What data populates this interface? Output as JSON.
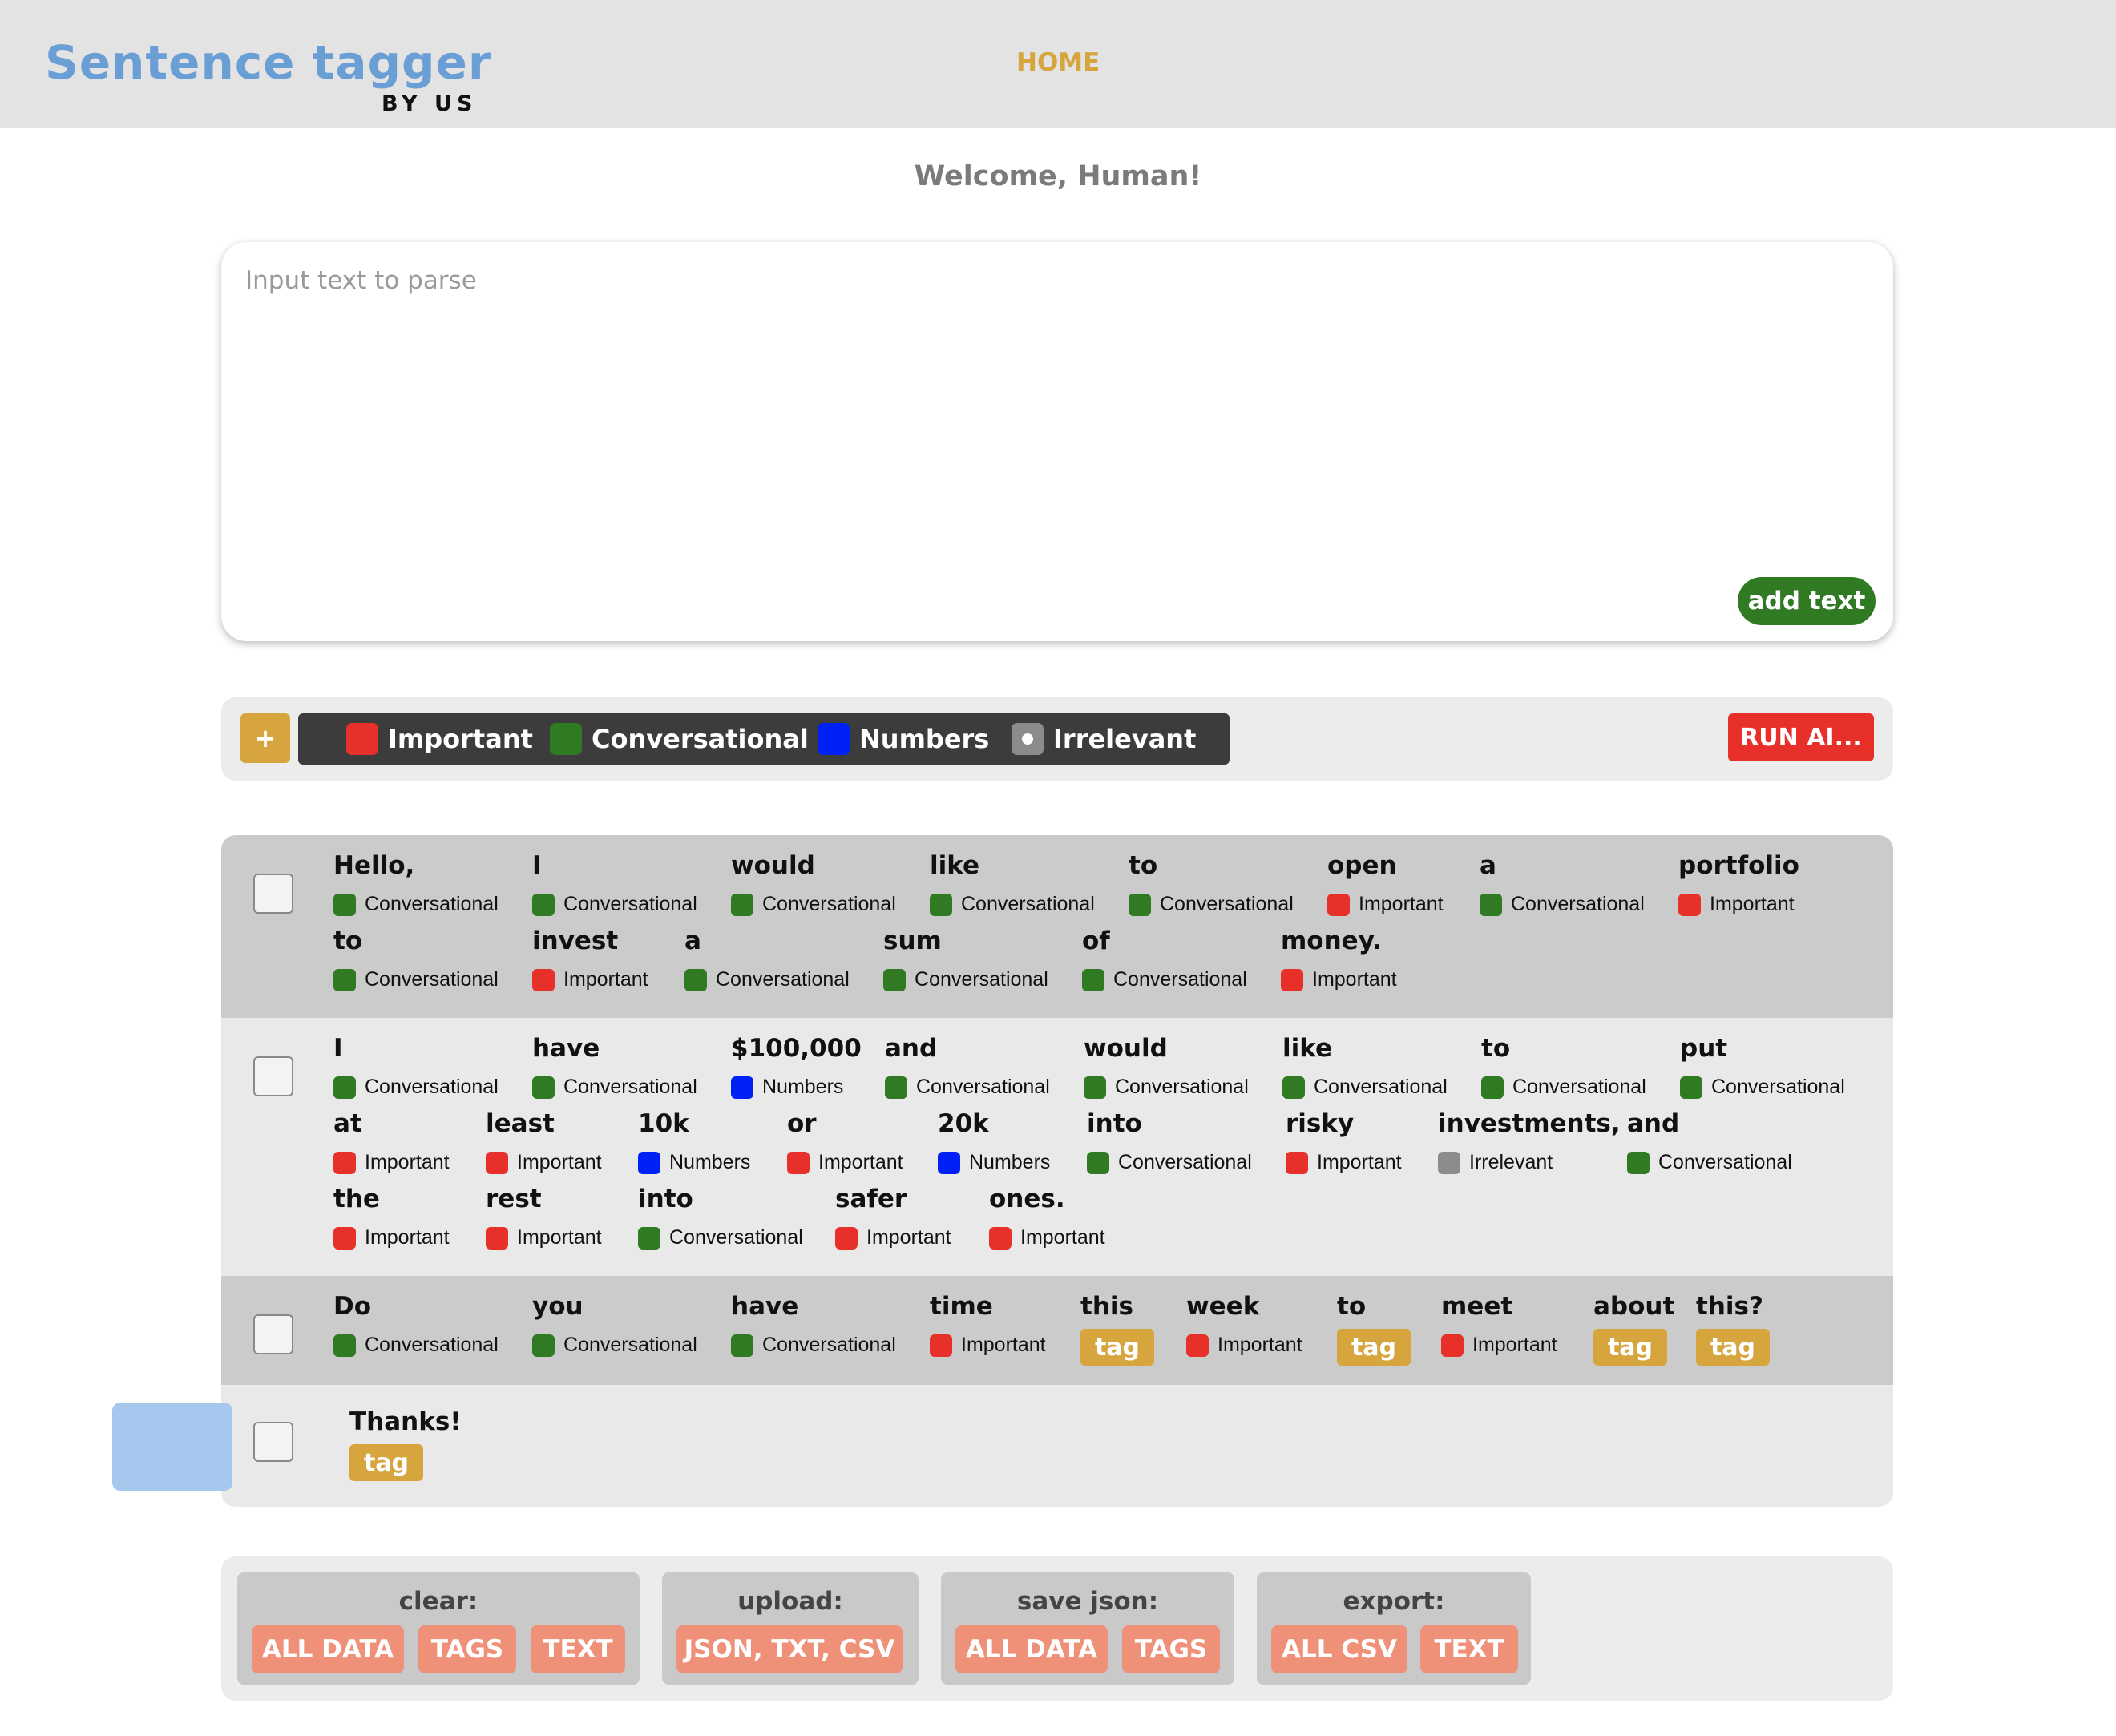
{
  "header": {
    "logo_title": "Sentence tagger",
    "logo_sub": "BY US",
    "nav": [
      {
        "label": "HOME"
      }
    ]
  },
  "welcome": "Welcome, Human!",
  "input": {
    "placeholder": "Input text to parse",
    "value": "",
    "add_label": "add text"
  },
  "toolbar": {
    "add_label": "+",
    "run_label": "RUN AI...",
    "legend": [
      {
        "label": "Important",
        "color": "#e8302a"
      },
      {
        "label": "Conversational",
        "color": "#2f7a22"
      },
      {
        "label": "Numbers",
        "color": "#0021f5"
      },
      {
        "label": "Irrelevant",
        "color": "#8c8c8c"
      }
    ]
  },
  "colors": {
    "Important": "#e8302a",
    "Conversational": "#2f7a22",
    "Numbers": "#0021f5",
    "Irrelevant": "#8c8c8c",
    "tag_button": "#d6a53e",
    "selected_token": "#a6c7ee",
    "action_button": "#ef9178"
  },
  "sentences": [
    {
      "checked": false,
      "tokens": [
        {
          "word": "Hello,",
          "tag": "Conversational"
        },
        {
          "word": "I",
          "tag": "Conversational"
        },
        {
          "word": "would",
          "tag": "Conversational"
        },
        {
          "word": "like",
          "tag": "Conversational"
        },
        {
          "word": "to",
          "tag": "Conversational"
        },
        {
          "word": "open",
          "tag": "Important"
        },
        {
          "word": "a",
          "tag": "Conversational"
        },
        {
          "word": "portfolio",
          "tag": "Important"
        },
        {
          "word": "to",
          "tag": "Conversational"
        },
        {
          "word": "invest",
          "tag": "Important"
        },
        {
          "word": "a",
          "tag": "Conversational"
        },
        {
          "word": "sum",
          "tag": "Conversational"
        },
        {
          "word": "of",
          "tag": "Conversational"
        },
        {
          "word": "money.",
          "tag": "Important"
        }
      ]
    },
    {
      "checked": false,
      "tokens": [
        {
          "word": "I",
          "tag": "Conversational"
        },
        {
          "word": "have",
          "tag": "Conversational"
        },
        {
          "word": "$100,000",
          "tag": "Numbers"
        },
        {
          "word": "and",
          "tag": "Conversational"
        },
        {
          "word": "would",
          "tag": "Conversational"
        },
        {
          "word": "like",
          "tag": "Conversational"
        },
        {
          "word": "to",
          "tag": "Conversational"
        },
        {
          "word": "put",
          "tag": "Conversational"
        },
        {
          "word": "at",
          "tag": "Important"
        },
        {
          "word": "least",
          "tag": "Important"
        },
        {
          "word": "10k",
          "tag": "Numbers"
        },
        {
          "word": "or",
          "tag": "Important"
        },
        {
          "word": "20k",
          "tag": "Numbers"
        },
        {
          "word": "into",
          "tag": "Conversational"
        },
        {
          "word": "risky",
          "tag": "Important"
        },
        {
          "word": "investments,",
          "tag": "Irrelevant"
        },
        {
          "word": "and",
          "tag": "Conversational"
        },
        {
          "word": "the",
          "tag": "Important"
        },
        {
          "word": "rest",
          "tag": "Important"
        },
        {
          "word": "into",
          "tag": "Conversational"
        },
        {
          "word": "safer",
          "tag": "Important"
        },
        {
          "word": "ones.",
          "tag": "Important"
        }
      ]
    },
    {
      "checked": false,
      "tokens": [
        {
          "word": "Do",
          "tag": "Conversational"
        },
        {
          "word": "you",
          "tag": "Conversational"
        },
        {
          "word": "have",
          "tag": "Conversational"
        },
        {
          "word": "time",
          "tag": "Important"
        },
        {
          "word": "this",
          "tag": null,
          "button": "tag"
        },
        {
          "word": "week",
          "tag": "Important"
        },
        {
          "word": "to",
          "tag": null,
          "button": "tag"
        },
        {
          "word": "meet",
          "tag": "Important"
        },
        {
          "word": "about",
          "tag": null,
          "button": "tag"
        },
        {
          "word": "this?",
          "tag": null,
          "button": "tag"
        }
      ]
    },
    {
      "checked": false,
      "tokens": [
        {
          "word": "Thanks!",
          "tag": null,
          "button": "tag",
          "selected": true
        }
      ]
    }
  ],
  "actions": [
    {
      "title": "clear:",
      "buttons": [
        "ALL DATA",
        "TAGS",
        "TEXT"
      ]
    },
    {
      "title": "upload:",
      "buttons": [
        "JSON, TXT, CSV"
      ]
    },
    {
      "title": "save json:",
      "buttons": [
        "ALL DATA",
        "TAGS"
      ]
    },
    {
      "title": "export:",
      "buttons": [
        "ALL CSV",
        "TEXT"
      ]
    }
  ]
}
